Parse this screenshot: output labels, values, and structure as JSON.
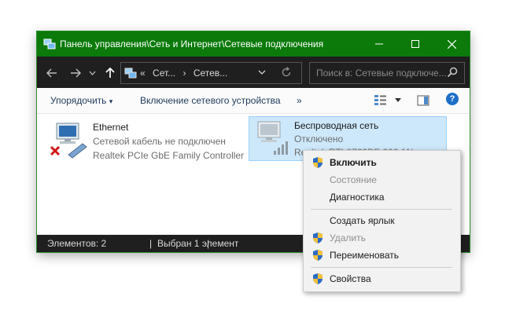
{
  "window": {
    "title": "Панель управления\\Сеть и Интернет\\Сетевые подключения",
    "colors": {
      "titlebar": "#0b7a0b",
      "toolbar": "#1f1f1f",
      "selection": "#cde8fa"
    }
  },
  "address": {
    "prefix": "«",
    "crumbs": [
      "Сет...",
      "Сетев..."
    ],
    "search_placeholder": "Поиск в: Сетевые подключе..."
  },
  "commands": {
    "organize": "Упорядочить",
    "enable_device": "Включение сетевого устройства",
    "more": "»"
  },
  "connections": [
    {
      "name": "Ethernet",
      "status": "Сетевой кабель не подключен",
      "device": "Realtek PCIe GbE Family Controller",
      "icon": "ethernet-adapter-icon",
      "state_icon": "red-x-icon"
    },
    {
      "name": "Беспроводная сеть",
      "status": "Отключено",
      "device": "Realtek RTL8723BE 802.11bgn...",
      "icon": "wireless-adapter-icon"
    }
  ],
  "status": {
    "count": "Элементов: 2",
    "selected": "Выбран 1 элемент",
    "sep": "|"
  },
  "context_menu": {
    "items": [
      {
        "label": "Включить",
        "bold": true,
        "shield": true,
        "disabled": false
      },
      {
        "label": "Состояние",
        "bold": false,
        "shield": false,
        "disabled": true
      },
      {
        "label": "Диагностика",
        "bold": false,
        "shield": false,
        "disabled": false
      },
      {
        "label": "Создать ярлык",
        "bold": false,
        "shield": false,
        "disabled": false
      },
      {
        "label": "Удалить",
        "bold": false,
        "shield": true,
        "disabled": true
      },
      {
        "label": "Переименовать",
        "bold": false,
        "shield": true,
        "disabled": false
      },
      {
        "label": "Свойства",
        "bold": false,
        "shield": true,
        "disabled": false
      }
    ]
  }
}
